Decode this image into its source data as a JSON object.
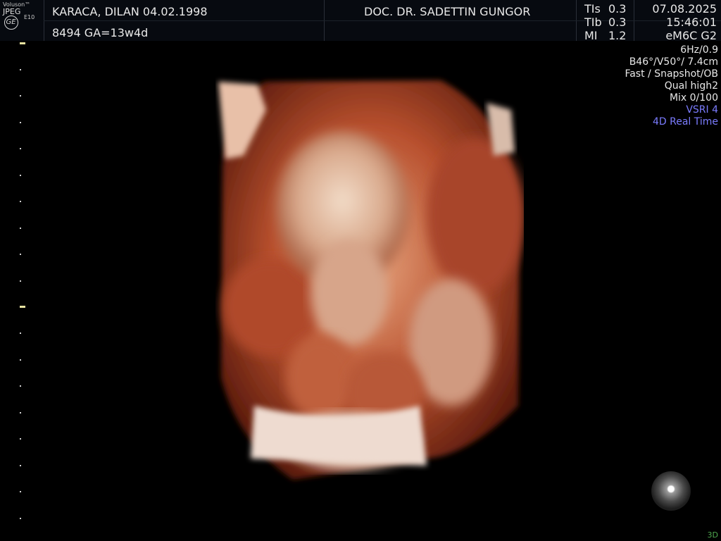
{
  "device": {
    "brand": "Voluson™",
    "model": "E10",
    "format": "JPEG",
    "logo": "GE"
  },
  "patient": {
    "name_dob": "KARACA, DILAN  04.02.1998",
    "id_ga": "8494  GA=13w4d"
  },
  "doctor": "DOC. DR. SADETTIN GUNGOR",
  "indices": [
    {
      "label": "TIs",
      "value": "0.3"
    },
    {
      "label": "TIb",
      "value": "0.3"
    },
    {
      "label": "MI",
      "value": "1.2"
    }
  ],
  "datetime": {
    "date": "07.08.2025",
    "time": "15:46:01",
    "probe": "eM6C G2"
  },
  "params": [
    "6Hz/0.9",
    "B46°/V50°/ 7.4cm",
    "Fast / Snapshot/OB",
    "Qual high2",
    "Mix 0/100"
  ],
  "params_blue": [
    "VSRI 4",
    "4D Real Time"
  ],
  "mode_label": "3D",
  "colors": {
    "header_bg": "#070a10",
    "accent_blue": "#7b7cff",
    "mode_green": "#4fa84f",
    "render_flesh": "#b8502e"
  },
  "icons": {
    "trackball": "trackball-icon",
    "logo": "ge-logo-icon"
  }
}
